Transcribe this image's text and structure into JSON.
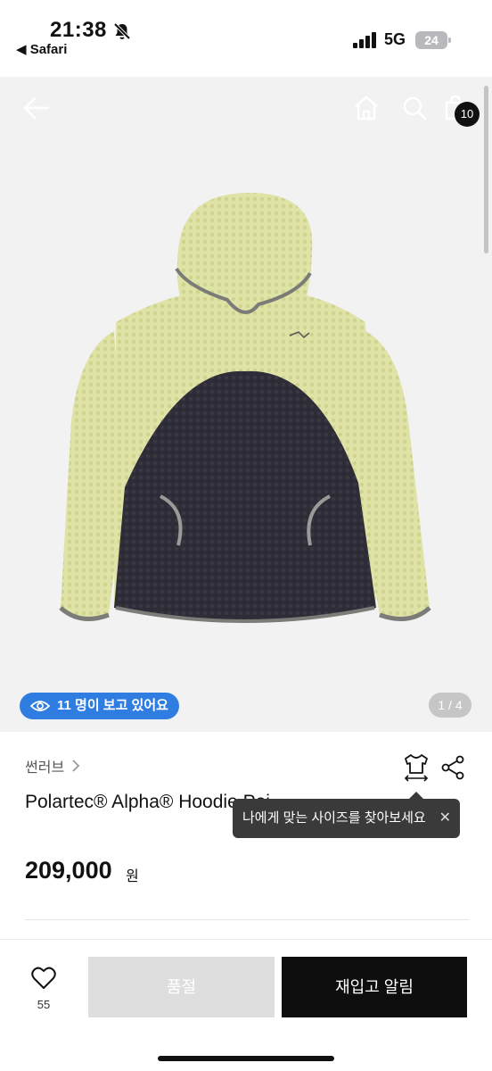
{
  "status_bar": {
    "time": "21:38",
    "back_app": "◀ Safari",
    "network": "5G",
    "battery": "24"
  },
  "gallery": {
    "cart_count": "10",
    "viewers": "11 명이 보고 있어요",
    "page_indicator": "1 / 4"
  },
  "product": {
    "brand": "썬러브",
    "title": "Polartec® Alpha® Hoodie Pei",
    "tooltip": "나에게 맞는 사이즈를 찾아보세요",
    "price": "209,000",
    "currency": "원"
  },
  "bottom_bar": {
    "like_count": "55",
    "soldout_label": "품절",
    "restock_label": "재입고 알림"
  },
  "colors": {
    "accent_blue": "#2f7de1",
    "hoodie_yellow": "#dfe3a6",
    "hoodie_navy": "#2e2c36",
    "button_black": "#0e0e0e",
    "button_disabled": "#dedede"
  },
  "icons": [
    "back-arrow-icon",
    "home-icon",
    "search-icon",
    "bag-icon",
    "eye-icon",
    "chevron-right-icon",
    "size-guide-icon",
    "share-icon",
    "close-icon",
    "heart-icon",
    "bell-slash-icon"
  ]
}
